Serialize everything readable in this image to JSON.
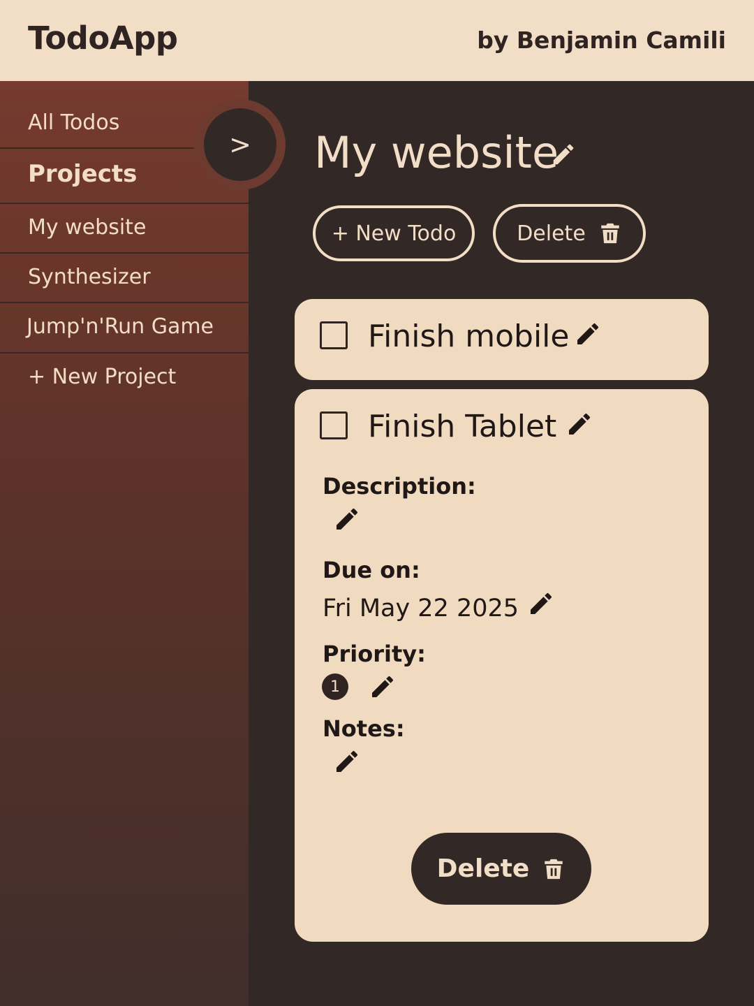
{
  "header": {
    "app_title": "TodoApp",
    "author": "by Benjamin Camili"
  },
  "sidebar": {
    "all_todos": "All Todos",
    "projects_heading": "Projects",
    "projects": [
      "My website",
      "Synthesizer",
      "Jump'n'Run Game"
    ],
    "new_project": "+ New Project",
    "toggle_label": ">"
  },
  "main": {
    "project_title": "My website",
    "new_todo_label": "+ New Todo",
    "delete_project_label": "Delete",
    "todos": [
      {
        "title": "Finish mobile",
        "checked": false,
        "expanded": false
      },
      {
        "title": "Finish Tablet",
        "checked": false,
        "expanded": true,
        "description_label": "Description:",
        "description": "",
        "due_label": "Due on:",
        "due_date": "Fri May 22 2025",
        "priority_label": "Priority:",
        "priority": "1",
        "notes_label": "Notes:",
        "notes": "",
        "delete_label": "Delete"
      }
    ]
  },
  "colors": {
    "header_bg": "#f2dec7",
    "main_bg": "#322826",
    "sidebar_top": "#763a2e",
    "card_bg": "#f1dbc0",
    "text_light": "#f2dec7",
    "text_dark": "#1f1816"
  },
  "icons": {
    "edit": "pencil-icon",
    "delete": "trash-icon"
  }
}
